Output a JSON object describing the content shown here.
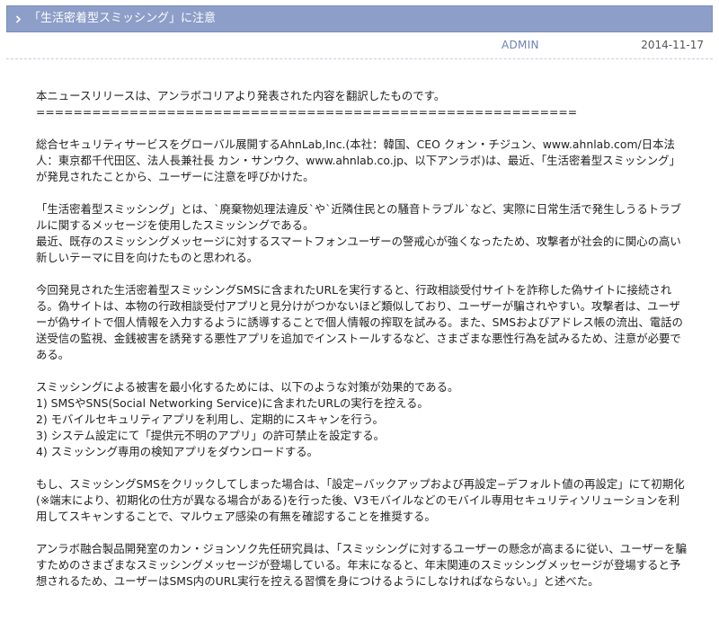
{
  "header": {
    "title": "「生活密着型スミッシング」に注意"
  },
  "meta": {
    "author": "ADMIN",
    "date": "2014-11-17"
  },
  "article": {
    "intro": "本ニュースリリースは、アンラボコリアより発表された内容を翻訳したものです。",
    "separator": "==========================================================",
    "p1": "総合セキュリティサービスをグローバル展開するAhnLab,Inc.(本社：韓国、CEO クォン・チジュン、www.ahnlab.com/日本法人：東京都千代田区、法人長兼社長 カン・サンウク、www.ahnlab.co.jp、以下アンラボ)は、最近、「生活密着型スミッシング」が発見されたことから、ユーザーに注意を呼びかけた。",
    "p2a": "「生活密着型スミッシング」とは、`廃棄物処理法違反`や`近隣住民との騒音トラブル`など、実際に日常生活で発生しうるトラブルに関するメッセージを使用したスミッシングである。",
    "p2b": "最近、既存のスミッシングメッセージに対するスマートフォンユーザーの警戒心が強くなったため、攻撃者が社会的に関心の高い新しいテーマに目を向けたものと思われる。",
    "p3": "今回発見された生活密着型スミッシングSMSに含まれたURLを実行すると、行政相談受付サイトを詐称した偽サイトに接続される。偽サイトは、本物の行政相談受付アプリと見分けがつかないほど類似しており、ユーザーが騙されやすい。攻撃者は、ユーザーが偽サイトで個人情報を入力するように誘導することで個人情報の搾取を試みる。また、SMSおよびアドレス帳の流出、電話の送受信の監視、金銭被害を誘発する悪性アプリを追加でインストールするなど、さまざまな悪性行為を試みるため、注意が必要である。",
    "p4_lead": "スミッシングによる被害を最小化するためには、以下のような対策が効果的である。",
    "p4_items": [
      "1) SMSやSNS(Social Networking Service)に含まれたURLの実行を控える。",
      "2) モバイルセキュリティアプリを利用し、定期的にスキャンを行う。",
      "3) システム設定にて「提供元不明のアプリ」の許可禁止を設定する。",
      "4) スミッシング専用の検知アプリをダウンロードする。"
    ],
    "p5": "もし、スミッシングSMSをクリックしてしまった場合は、「設定−バックアップおよび再設定−デフォルト値の再設定」にて初期化(※端末により、初期化の仕方が異なる場合がある)を行った後、V3モバイルなどのモバイル専用セキュリティソリューションを利用してスキャンすることで、マルウェア感染の有無を確認することを推奨する。",
    "p6": "アンラボ融合製品開発室のカン・ジョンソク先任研究員は、「スミッシングに対するユーザーの懸念が高まるに従い、ユーザーを騙すためのさまざまなスミッシングメッセージが登場している。年末になると、年末関連のスミッシングメッセージが登場すると予想されるため、ユーザーはSMS内のURL実行を控える習慣を身につけるようにしなければならない。」と述べた。"
  },
  "colors": {
    "title_bar_bg": "#8d9ec9",
    "author_color": "#6d82b5"
  },
  "icons": {
    "title_bullet": "chevron-right-icon"
  }
}
